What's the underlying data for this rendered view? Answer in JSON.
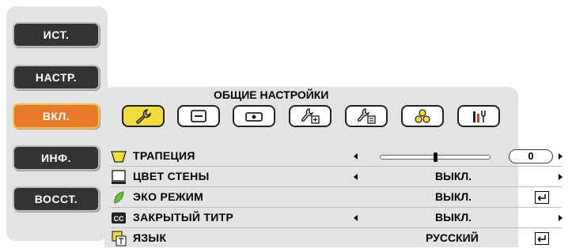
{
  "left_menu": {
    "items": [
      {
        "label": "ИСТ.",
        "active": false
      },
      {
        "label": "НАСТР.",
        "active": false
      },
      {
        "label": "ВКЛ.",
        "active": true
      },
      {
        "label": "ИНФ.",
        "active": false
      },
      {
        "label": "ВОССТ.",
        "active": false
      }
    ]
  },
  "panel": {
    "title": "ОБЩИЕ НАСТРОЙКИ",
    "tabs": [
      {
        "icon": "wrench-icon",
        "active": true
      },
      {
        "icon": "menu-icon",
        "active": false
      },
      {
        "icon": "projector-icon",
        "active": false
      },
      {
        "icon": "wrench-plus-icon",
        "active": false
      },
      {
        "icon": "wrench-settings-icon",
        "active": false
      },
      {
        "icon": "network-icon",
        "active": false
      },
      {
        "icon": "tools-icon",
        "active": false
      }
    ]
  },
  "settings": {
    "rows": [
      {
        "label": "ТРАПЕЦИЯ",
        "icon": "trapezoid-icon",
        "value": "0",
        "slider_fraction": 0.5
      },
      {
        "label": "ЦВЕТ СТЕНЫ",
        "icon": "wall-color-icon",
        "value": "ВЫКЛ."
      },
      {
        "label": "ЭКО РЕЖИМ",
        "icon": "leaf-icon",
        "value": "ВЫКЛ."
      },
      {
        "label": "ЗАКРЫТЫЙ ТИТР",
        "icon": "cc-icon",
        "value": "ВЫКЛ."
      },
      {
        "label": "ЯЗЫК",
        "icon": "language-icon",
        "value": "РУССКИЙ"
      }
    ]
  },
  "colors": {
    "active_menu": "#e8792a",
    "active_tab": "#f3dc3a",
    "panel_bg": "#e3e3e3"
  }
}
